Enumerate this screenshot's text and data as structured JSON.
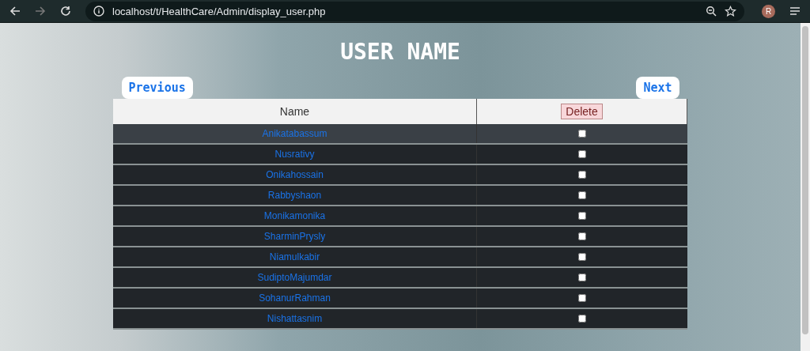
{
  "browser": {
    "url": "localhost/t/HealthCare/Admin/display_user.php",
    "profile_initial": "R"
  },
  "page": {
    "title": "USER NAME",
    "previous": "Previous",
    "next": "Next"
  },
  "table": {
    "columns": [
      "Name"
    ],
    "delete_button": "Delete",
    "rows": [
      {
        "name": "Anikatabassum",
        "checked": false,
        "hovered": true
      },
      {
        "name": "Nusrativy",
        "checked": false,
        "hovered": false
      },
      {
        "name": "Onikahossain",
        "checked": false,
        "hovered": false
      },
      {
        "name": "Rabbyshaon",
        "checked": false,
        "hovered": false
      },
      {
        "name": "Monikamonika",
        "checked": false,
        "hovered": false
      },
      {
        "name": "SharminPrysly",
        "checked": false,
        "hovered": false
      },
      {
        "name": "Niamulkabir",
        "checked": false,
        "hovered": false
      },
      {
        "name": "SudiptoMajumdar",
        "checked": false,
        "hovered": false
      },
      {
        "name": "SohanurRahman",
        "checked": false,
        "hovered": false
      },
      {
        "name": "Nishattasnim",
        "checked": false,
        "hovered": false
      }
    ]
  }
}
